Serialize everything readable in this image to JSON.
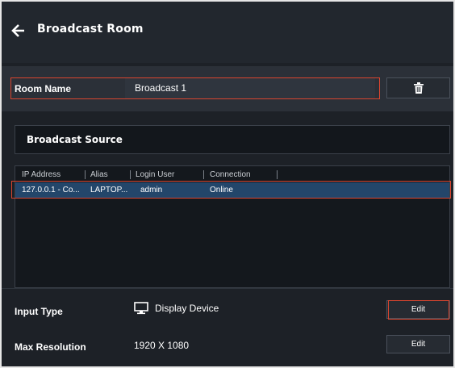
{
  "header": {
    "title": "Broadcast Room",
    "back_icon": "arrow-left-icon"
  },
  "room": {
    "label": "Room Name",
    "value": "Broadcast 1",
    "delete_icon": "trash-icon"
  },
  "source": {
    "title": "Broadcast Source",
    "columns": [
      "IP Address",
      "Alias",
      "Login User",
      "Connection"
    ],
    "rows": [
      {
        "ip": "127.0.0.1 - Co...",
        "alias": "LAPTOP...",
        "user": "admin",
        "connection": "Online"
      }
    ]
  },
  "input_type": {
    "label": "Input Type",
    "value": "Display Device",
    "icon": "monitor-icon",
    "edit_label": "Edit"
  },
  "max_resolution": {
    "label": "Max Resolution",
    "value": "1920 X 1080",
    "edit_label": "Edit"
  },
  "colors": {
    "highlight": "#d9452f",
    "selected_row": "#23466a",
    "background": "#1d2127"
  }
}
